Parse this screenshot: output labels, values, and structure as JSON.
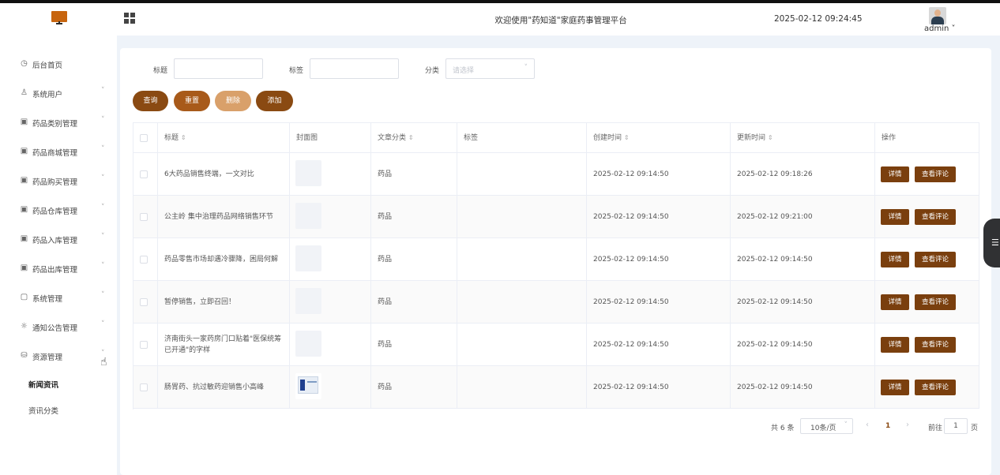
{
  "header": {
    "welcome": "欢迎使用\"药知道\"家庭药事管理平台",
    "datetime": "2025-02-12 09:24:45",
    "username": "admin",
    "user_caret": "˅"
  },
  "sidebar": {
    "items": [
      {
        "label": "后台首页",
        "icon": "clock-icon",
        "glyph": "◷",
        "chevron": false
      },
      {
        "label": "系统用户",
        "icon": "user-icon",
        "glyph": "♙",
        "chevron": true
      },
      {
        "label": "药品类别管理",
        "icon": "grid-box-icon",
        "glyph": "▣",
        "chevron": true
      },
      {
        "label": "药品商城管理",
        "icon": "grid-box-icon",
        "glyph": "▣",
        "chevron": true
      },
      {
        "label": "药品购买管理",
        "icon": "grid-box-icon",
        "glyph": "▣",
        "chevron": true
      },
      {
        "label": "药品仓库管理",
        "icon": "grid-box-icon",
        "glyph": "▣",
        "chevron": true
      },
      {
        "label": "药品入库管理",
        "icon": "grid-box-icon",
        "glyph": "▣",
        "chevron": true
      },
      {
        "label": "药品出库管理",
        "icon": "grid-box-icon",
        "glyph": "▣",
        "chevron": true
      },
      {
        "label": "系统管理",
        "icon": "folder-icon",
        "glyph": "▢",
        "chevron": true
      },
      {
        "label": "通知公告管理",
        "icon": "sun-icon",
        "glyph": "☼",
        "chevron": true
      },
      {
        "label": "资源管理",
        "icon": "database-icon",
        "glyph": "⛁",
        "chevron": true
      }
    ],
    "sub_items": [
      {
        "label": "新闻资讯",
        "active": true
      },
      {
        "label": "资讯分类",
        "active": false
      }
    ],
    "chevron": "˅"
  },
  "filters": {
    "title_label": "标题",
    "tag_label": "标签",
    "category_label": "分类",
    "category_placeholder": "请选择",
    "select_arrow": "˅"
  },
  "buttons": {
    "query": "查询",
    "reset": "重置",
    "delete": "删除",
    "add": "添加"
  },
  "table": {
    "headers": {
      "title": "标题",
      "cover": "封面图",
      "category": "文章分类",
      "tags": "标签",
      "created": "创建时间",
      "updated": "更新时间",
      "actions": "操作"
    },
    "sort_glyph": "⇕",
    "rows": [
      {
        "title": "6大药品销售终端，一文对比",
        "category": "药品",
        "tags": "",
        "created": "2025-02-12 09:14:50",
        "updated": "2025-02-12 09:18:26",
        "has_image": false
      },
      {
        "title": "公主岭 集中治理药品网络销售环节",
        "category": "药品",
        "tags": "",
        "created": "2025-02-12 09:14:50",
        "updated": "2025-02-12 09:21:00",
        "has_image": false
      },
      {
        "title": "药品零售市场却遇冷骤降，困局何解",
        "category": "药品",
        "tags": "",
        "created": "2025-02-12 09:14:50",
        "updated": "2025-02-12 09:14:50",
        "has_image": false
      },
      {
        "title": "暂停销售，立即召回！",
        "category": "药品",
        "tags": "",
        "created": "2025-02-12 09:14:50",
        "updated": "2025-02-12 09:14:50",
        "has_image": false
      },
      {
        "title": "济南街头一家药房门口贴着\"医保统筹已开通\"的字样",
        "category": "药品",
        "tags": "",
        "created": "2025-02-12 09:14:50",
        "updated": "2025-02-12 09:14:50",
        "has_image": false
      },
      {
        "title": "肠胃药、抗过敏药迎销售小高峰",
        "category": "药品",
        "tags": "",
        "created": "2025-02-12 09:14:50",
        "updated": "2025-02-12 09:14:50",
        "has_image": true
      }
    ],
    "detail_label": "详情",
    "comments_label": "查看评论"
  },
  "pagination": {
    "total": "共 6 条",
    "page_size": "10条/页",
    "size_arrow": "˅",
    "prev": "‹",
    "current": "1",
    "next": "›",
    "goto": "前往",
    "goto_value": "1",
    "page_suffix": "页"
  },
  "side_tab_glyph": "☰",
  "colors": {
    "accent_dark": "#8a4a12",
    "accent_mid": "#a85a1a",
    "accent_light": "#d9a06a",
    "action_btn": "#7a3f0e"
  }
}
